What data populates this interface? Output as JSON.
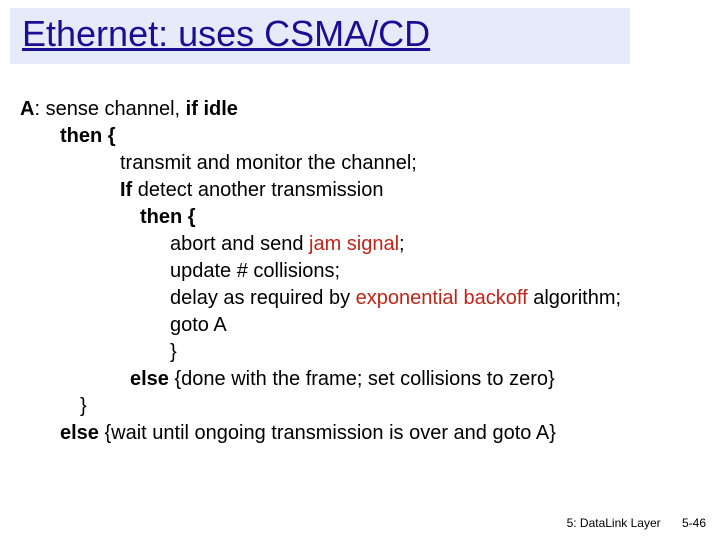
{
  "title": "Ethernet: uses CSMA/CD",
  "body": {
    "lineA_pre": "A",
    "lineA_mid": ": sense channel, ",
    "lineA_post": "if idle",
    "then1": "then {",
    "transmit": "transmit and monitor the channel;",
    "if_pre": "If ",
    "if_post": "detect another transmission",
    "then2": "then {",
    "abort_pre": "abort and send ",
    "abort_jam": "jam signal",
    "abort_post": ";",
    "update": "update # collisions;",
    "delay_pre": "delay as required by ",
    "delay_exp": "exponential backoff ",
    "delay_post": "algorithm;",
    "goto": "goto A",
    "closebrace": "}",
    "else2_pre": "else ",
    "else2_post": "{done with the frame; set collisions to zero}",
    "closebrace2": "}",
    "else1_pre": "else ",
    "else1_post": "{wait until ongoing transmission is over and goto A}"
  },
  "footer": {
    "left": "5: DataLink Layer",
    "right": "5-46"
  }
}
